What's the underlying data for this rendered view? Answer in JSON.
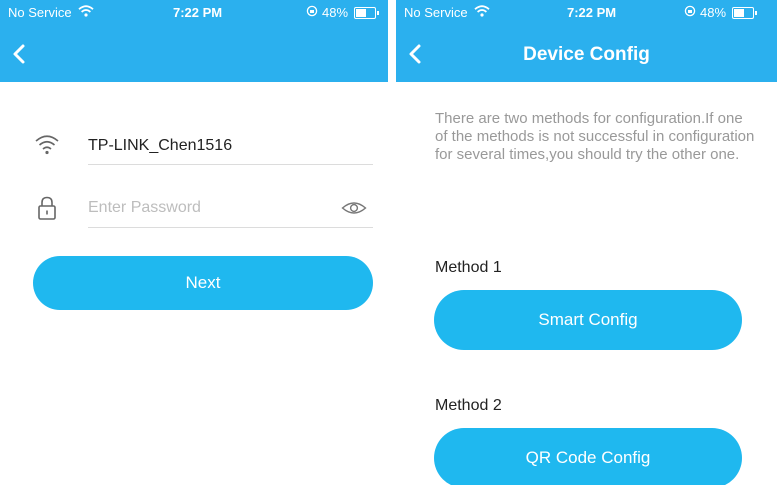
{
  "colors": {
    "header": "#2bb0ee",
    "button": "#1fb8ef",
    "description_text": "#999999",
    "primary_text": "#222222",
    "divider": "#dcdcdc"
  },
  "left_screen": {
    "status": {
      "carrier": "No Service",
      "time": "7:22 PM",
      "battery": "48%"
    },
    "wifi": {
      "ssid": "TP-LINK_Chen1516",
      "icon": "wifi-icon"
    },
    "password": {
      "placeholder": "Enter Password",
      "value": "",
      "icon": "lock-icon",
      "toggle_icon": "eye-icon"
    },
    "next_label": "Next"
  },
  "right_screen": {
    "status": {
      "carrier": "No Service",
      "time": "7:22 PM",
      "battery": "48%"
    },
    "title": "Device Config",
    "description": "There are two methods for configuration.If one of the methods is not successful in configuration for several times,you should try the other one.",
    "method1_label": "Method 1",
    "method1_button": "Smart Config",
    "method2_label": "Method 2",
    "method2_button": "QR Code Config"
  }
}
